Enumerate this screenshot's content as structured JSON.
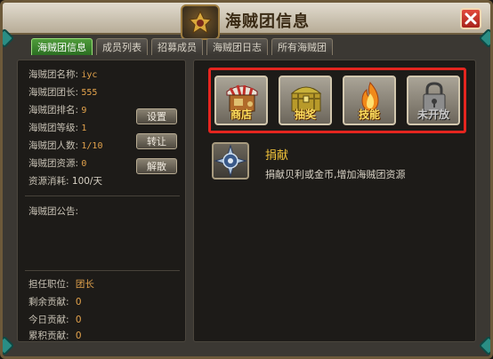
{
  "window": {
    "title": "海贼团信息"
  },
  "tabs": [
    {
      "label": "海贼团信息",
      "active": true
    },
    {
      "label": "成员列表",
      "active": false
    },
    {
      "label": "招募成员",
      "active": false
    },
    {
      "label": "海贼团日志",
      "active": false
    },
    {
      "label": "所有海贼团",
      "active": false
    }
  ],
  "info": {
    "name_label": "海贼团名称:",
    "name_value": "iyc",
    "leader_label": "海贼团团长:",
    "leader_value": "555",
    "rank_label": "海贼团排名:",
    "rank_value": "9",
    "level_label": "海贼团等级:",
    "level_value": "1",
    "members_label": "海贼团人数:",
    "members_value": "1/10",
    "resource_label": "海贼团资源:",
    "resource_value": "0",
    "consume_label": "资源消耗:",
    "consume_value": "100/天"
  },
  "buttons": {
    "settings": "设置",
    "transfer": "转让",
    "disband": "解散"
  },
  "notice_label": "海贼团公告:",
  "stats": {
    "position_label": "担任职位:",
    "position_value": "团长",
    "remaining_label": "剩余贡献:",
    "remaining_value": "0",
    "today_label": "今日贡献:",
    "today_value": "0",
    "total_label": "累积贡献:",
    "total_value": "0"
  },
  "functions": [
    {
      "label": "商店",
      "icon": "shop-icon"
    },
    {
      "label": "抽奖",
      "icon": "treasure-chest-icon"
    },
    {
      "label": "技能",
      "icon": "flame-icon"
    },
    {
      "label": "未开放",
      "icon": "lock-icon"
    }
  ],
  "donate": {
    "title": "捐献",
    "description": "捐献贝利或金币,增加海贼团资源"
  },
  "colors": {
    "accent_red": "#e5251f",
    "active_tab": "#2b6e22",
    "value_orange": "#e3a34c",
    "gold_text": "#f0c23a"
  }
}
